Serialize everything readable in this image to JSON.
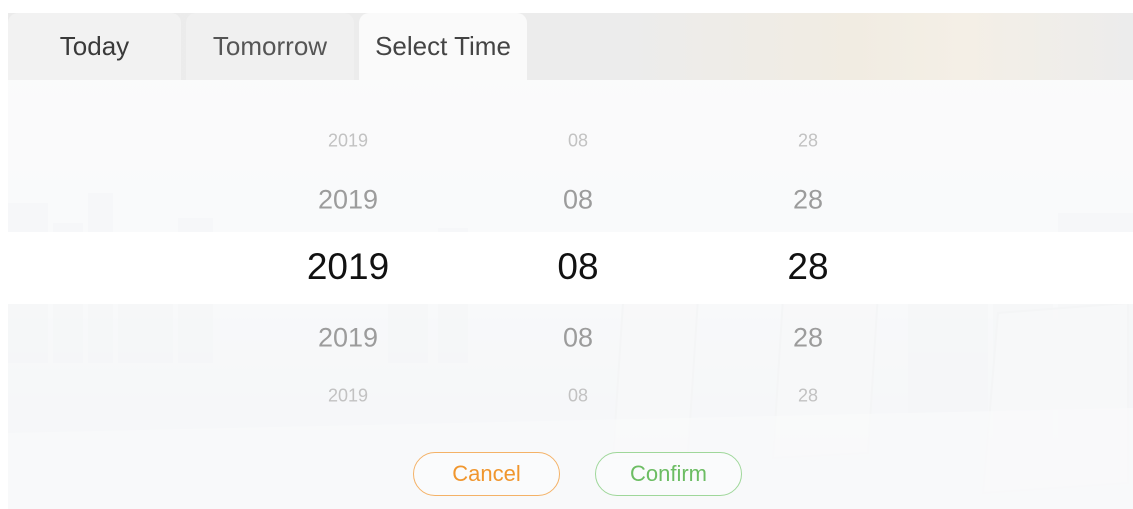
{
  "tabs": [
    {
      "label": "Today"
    },
    {
      "label": "Tomorrow"
    },
    {
      "label": "Select Time"
    }
  ],
  "selected_tab": "Select Time",
  "picker": {
    "year": [
      "2019",
      "2019",
      "2019",
      "2019",
      "2019"
    ],
    "month": [
      "08",
      "08",
      "08",
      "08",
      "08"
    ],
    "day": [
      "28",
      "28",
      "28",
      "28",
      "28"
    ]
  },
  "buttons": {
    "cancel_label": "Cancel",
    "confirm_label": "Confirm"
  },
  "colors": {
    "cancel_accent": "#f0962e",
    "confirm_accent": "#6cbd63",
    "selected_text": "#111111"
  }
}
